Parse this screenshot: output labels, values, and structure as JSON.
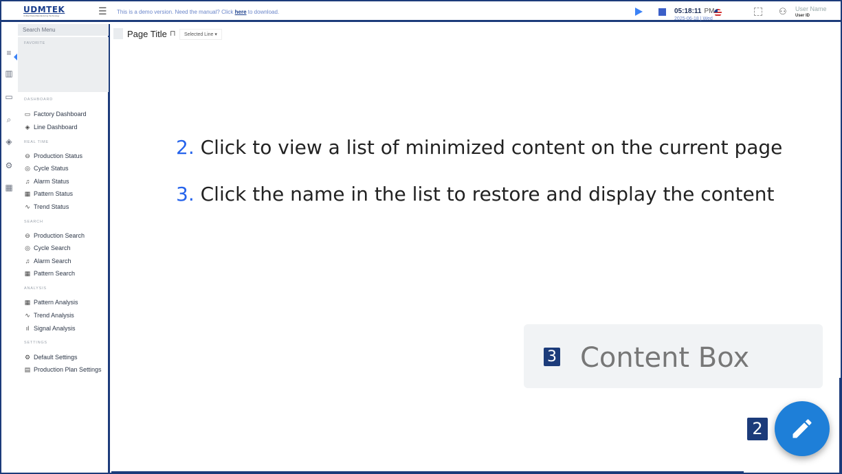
{
  "app": {
    "logo": "UDMTEK",
    "logo_sub": "Unified Data Manufacturing Technology"
  },
  "topbar": {
    "demo_prefix": "This is a demo version. Need the manual? Click ",
    "demo_link": "here",
    "demo_suffix": " to download.",
    "time": "05:18:11",
    "ampm": "PM",
    "date": "2025-06-18 | Wed",
    "user_name": "User Name",
    "user_id": "User ID"
  },
  "sidebar": {
    "search_placeholder": "Search Menu",
    "favorite_label": "FAVORITE",
    "sections": [
      {
        "label": "DASHBOARD",
        "items": [
          "Factory Dashboard",
          "Line Dashboard"
        ]
      },
      {
        "label": "REAL TIME",
        "items": [
          "Production Status",
          "Cycle Status",
          "Alarm Status",
          "Pattern Status",
          "Trend Status"
        ]
      },
      {
        "label": "SEARCH",
        "items": [
          "Production Search",
          "Cycle Search",
          "Alarm Search",
          "Pattern Search"
        ]
      },
      {
        "label": "ANALYSIS",
        "items": [
          "Pattern Analysis",
          "Trend Analysis",
          "Signal Analysis"
        ]
      },
      {
        "label": "SETTINGS",
        "items": [
          "Default Settings",
          "Production Plan Settings"
        ]
      }
    ]
  },
  "main": {
    "page_title": "Page Title",
    "selected_line": "Selected Line ▾",
    "instruction_2_num": "2.",
    "instruction_2_text": " Click to view a list of minimized content on the current page",
    "instruction_3_num": "3.",
    "instruction_3_text": " Click the name in the list to restore and display the content",
    "content_box_badge": "3",
    "content_box_label": "Content Box",
    "fab_badge": "2"
  },
  "colors": {
    "frame": "#1c3b7a",
    "accent": "#2563eb",
    "fab": "#1e7fd8"
  }
}
